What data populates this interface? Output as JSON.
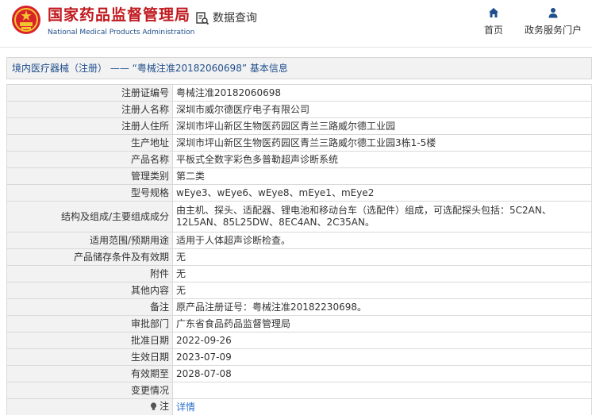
{
  "header": {
    "brand_cn": "国家药品监督管理局",
    "brand_en": "National Medical Products Administration",
    "query_label": "数据查询",
    "nav": [
      {
        "label": "首页",
        "icon": "home-icon"
      },
      {
        "label": "政务服务门户",
        "icon": "user-icon"
      }
    ]
  },
  "page_title": "境内医疗器械（注册） —— “粤械注准20182060698” 基本信息",
  "rows": [
    {
      "label": "注册证编号",
      "value": "粤械注准20182060698"
    },
    {
      "label": "注册人名称",
      "value": "深圳市威尔德医疗电子有限公司"
    },
    {
      "label": "注册人住所",
      "value": "深圳市坪山新区生物医药园区青兰三路威尔德工业园"
    },
    {
      "label": "生产地址",
      "value": "深圳市坪山新区生物医药园区青兰三路威尔德工业园3栋1-5楼"
    },
    {
      "label": "产品名称",
      "value": "平板式全数字彩色多普勒超声诊断系统"
    },
    {
      "label": "管理类别",
      "value": "第二类"
    },
    {
      "label": "型号规格",
      "value": "wEye3、wEye6、wEye8、mEye1、mEye2"
    },
    {
      "label": "结构及组成/主要组成成分",
      "value": "由主机、探头、适配器、锂电池和移动台车（选配件）组成，可选配探头包括：5C2AN、12L5AN、85L25DW、8EC4AN、2C35AN。"
    },
    {
      "label": "适用范围/预期用途",
      "value": "适用于人体超声诊断检查。"
    },
    {
      "label": "产品储存条件及有效期",
      "value": "无"
    },
    {
      "label": "附件",
      "value": "无"
    },
    {
      "label": "其他内容",
      "value": "无"
    },
    {
      "label": "备注",
      "value": "原产品注册证号：粤械注准20182230698。"
    },
    {
      "label": "审批部门",
      "value": "广东省食品药品监督管理局"
    },
    {
      "label": "批准日期",
      "value": "2022-09-26"
    },
    {
      "label": "生效日期",
      "value": "2023-07-09"
    },
    {
      "label": "有效期至",
      "value": "2028-07-08"
    },
    {
      "label": "变更情况",
      "value": ""
    }
  ],
  "note": {
    "label": "注",
    "link_text": "详情",
    "icon": "lightbulb-icon"
  },
  "colors": {
    "brand_red": "#c0191e",
    "brand_blue": "#1f4e8c",
    "link_blue": "#2a6fc9",
    "label_bg": "#f2f2f2"
  }
}
